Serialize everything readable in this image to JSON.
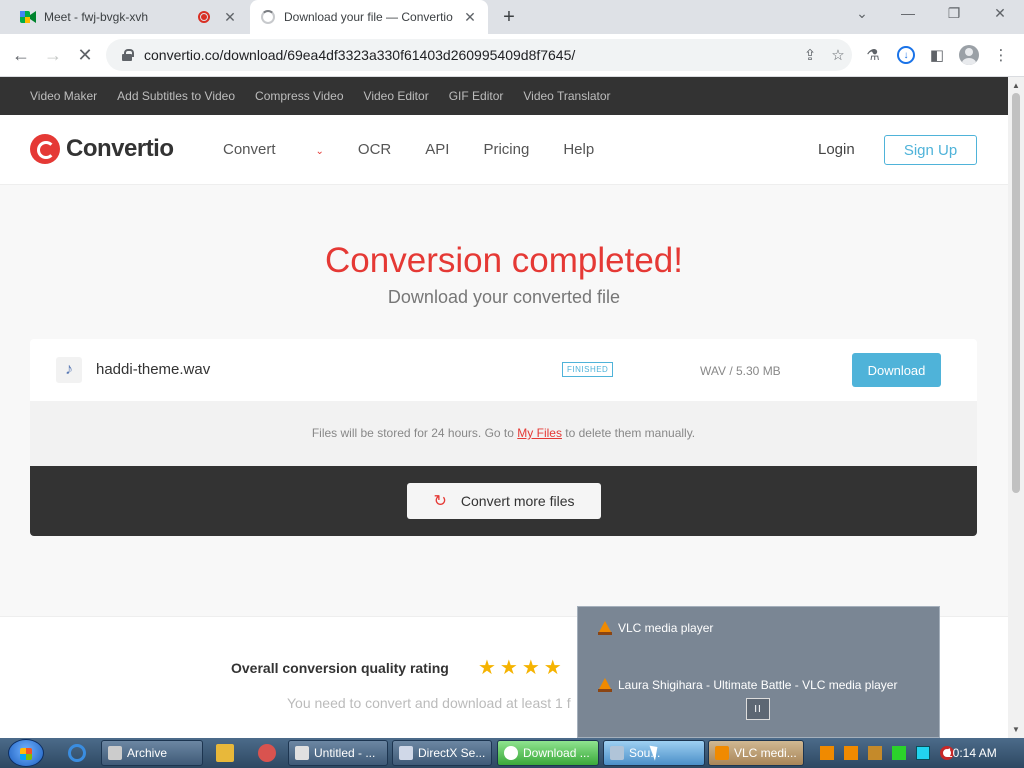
{
  "browser": {
    "tabs": [
      {
        "title": "Meet - fwj-bvgk-xvh"
      },
      {
        "title": "Download your file — Convertio"
      }
    ],
    "url": "convertio.co/download/69ea4df3323a330f61403d260995409d8f7645/"
  },
  "page": {
    "topbar_links": [
      "Video Maker",
      "Add Subtitles to Video",
      "Compress Video",
      "Video Editor",
      "GIF Editor",
      "Video Translator"
    ],
    "logo_text": "Convertio",
    "nav": {
      "convert": "Convert",
      "ocr": "OCR",
      "api": "API",
      "pricing": "Pricing",
      "help": "Help"
    },
    "login": "Login",
    "signup": "Sign Up",
    "hero_title": "Conversion completed!",
    "hero_subtitle": "Download your converted file",
    "file": {
      "name": "haddi-theme.wav",
      "status": "FINISHED",
      "meta": "WAV / 5.30 MB",
      "download_label": "Download"
    },
    "store_note": {
      "before": "Files will be stored for 24 hours. Go to ",
      "link": "My Files",
      "after": " to delete them manually."
    },
    "convert_more": "Convert more files",
    "rating_label": "Overall conversion quality rating",
    "rating_stars": "★★★★",
    "rating_note": "You need to convert and download at least 1 f"
  },
  "vlc_popup": {
    "items": [
      "VLC media player",
      "Laura Shigihara - Ultimate Battle - VLC media player"
    ],
    "pause_glyph": "II"
  },
  "taskbar": {
    "buttons": [
      "Archive",
      "Untitled - ...",
      "DirectX Se...",
      "Download ...",
      "Sou...",
      "VLC medi..."
    ],
    "clock": "10:14 AM"
  },
  "colors": {
    "brand_red": "#e53935",
    "accent_blue": "#4fb3d9"
  }
}
